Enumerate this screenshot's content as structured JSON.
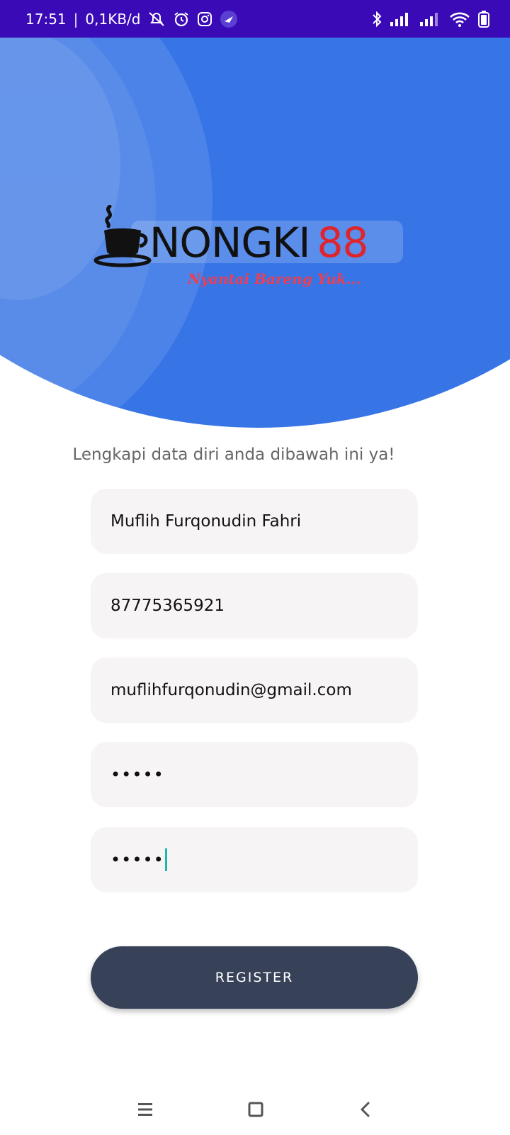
{
  "status_bar": {
    "time": "17:51",
    "network_speed": "0,1KB/d",
    "left_icons": [
      "muted-notification-icon",
      "alarm-icon",
      "instagram-icon",
      "app-icon"
    ],
    "right_icons": [
      "bluetooth-icon",
      "signal-icon",
      "signal-icon",
      "wifi-icon",
      "battery-icon"
    ]
  },
  "logo": {
    "name": "NONGKI",
    "number": "88",
    "tagline": "Nyantai Bareng Yuk..."
  },
  "form": {
    "instructions": "Lengkapi data diri anda dibawah ini ya!",
    "full_name": "Muflih Furqonudin Fahri",
    "phone": "87775365921",
    "email": "muflihfurqonudin@gmail.com",
    "password": "•••••",
    "confirm_password": "•••••",
    "register_label": "REGISTER"
  },
  "colors": {
    "status_bar": "#3a0ab6",
    "hero_blue": "#3775e6",
    "button": "#374259",
    "field_bg": "#f7f4f5",
    "logo_accent": "#e0242b"
  },
  "nav_bar": {
    "icons": [
      "menu-icon",
      "home-icon",
      "back-icon"
    ]
  }
}
